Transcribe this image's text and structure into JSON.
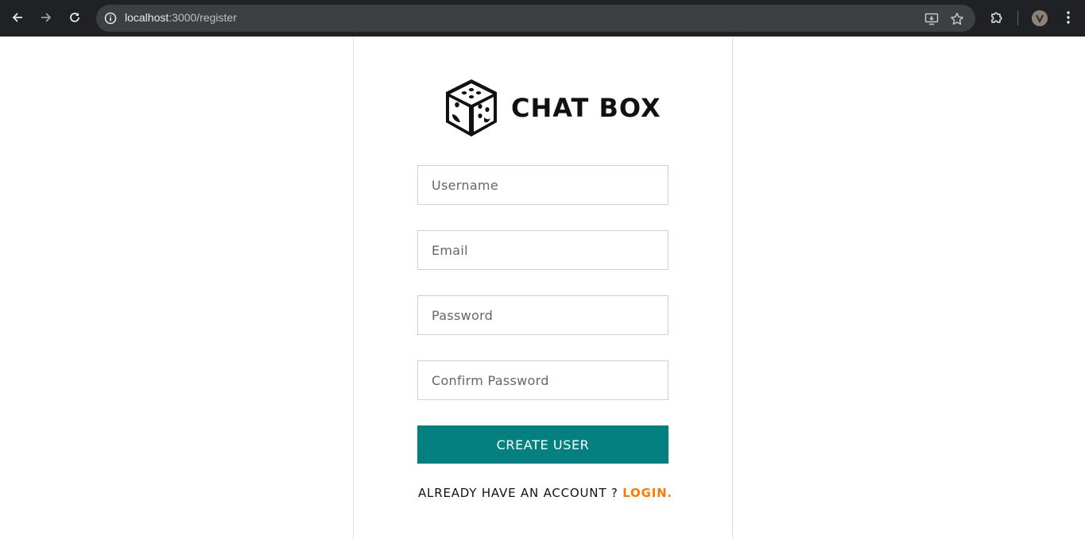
{
  "browser": {
    "url_host": "localhost",
    "url_path": ":3000/register",
    "icons": {
      "back": "back-arrow-icon",
      "forward": "forward-arrow-icon",
      "reload": "reload-icon",
      "site_info": "info-icon",
      "install": "install-app-icon",
      "bookmark": "star-icon",
      "extensions": "puzzle-icon",
      "menu": "kebab-menu-icon"
    }
  },
  "brand": {
    "title": "CHAT BOX",
    "logo_icon": "dice-logo-icon"
  },
  "form": {
    "username_placeholder": "Username",
    "email_placeholder": "Email",
    "password_placeholder": "Password",
    "confirm_placeholder": "Confirm Password",
    "submit_label": "CREATE USER"
  },
  "footer": {
    "prompt": "ALREADY HAVE AN ACCOUNT ? ",
    "link_label": "LOGIN."
  },
  "colors": {
    "accent": "#048080",
    "link": "#ff7a00",
    "chrome_bg": "#202124"
  }
}
